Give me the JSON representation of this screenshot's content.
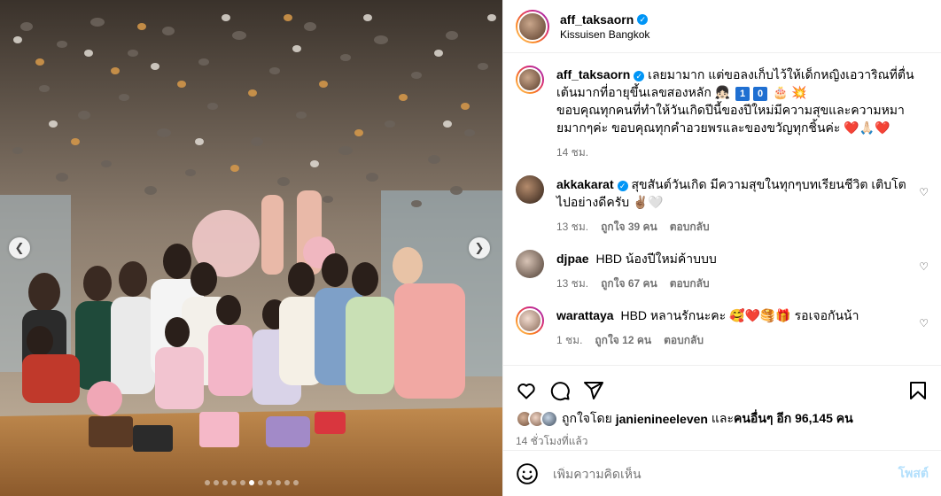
{
  "post": {
    "username": "aff_taksaorn",
    "location": "Kissuisen Bangkok",
    "caption_part1": "เลยมามาก แต่ขอลงเก็บไว้ให้เด็กหญิงเอวาริณที่ตื่นเต้นมากที่อายุขึ้นเลขสองหลัก",
    "caption_digit1": "1",
    "caption_digit2": "0",
    "caption_part2": "ขอบคุณทุกคนที่ทำให้วันเกิดปีนี้ของปีใหม่มีความสุขและความหมายมากๆค่ะ ขอบคุณทุกคำอวยพรและของขวัญทุกชิ้นค่ะ",
    "caption_time": "14 ชม.",
    "carousel_total": 11,
    "carousel_active": 5
  },
  "comments": [
    {
      "user": "akkakarat",
      "verified": true,
      "text": "สุขสันต์วันเกิด มีความสุขในทุกๆบทเรียนชีวิต เติบโตไปอย่างดีครับ ✌🏽🤍",
      "time": "13 ชม.",
      "likes": "ถูกใจ 39 คน",
      "reply": "ตอบกลับ"
    },
    {
      "user": "djpae",
      "verified": false,
      "text": "HBD น้องปีใหม่ค้าบบบ",
      "time": "13 ชม.",
      "likes": "ถูกใจ 67 คน",
      "reply": "ตอบกลับ"
    },
    {
      "user": "warattaya",
      "verified": false,
      "text": "HBD หลานรักนะคะ 🥰❤️🥞🎁 รอเจอกันน้า",
      "time": "1 ชม.",
      "likes": "ถูกใจ 12 คน",
      "reply": "ตอบกลับ"
    }
  ],
  "likes": {
    "prefix": "ถูกใจโดย",
    "user": "janienineeleven",
    "middle": "และ",
    "others": "คนอื่นๆ อีก 96,145 คน"
  },
  "timestamp": "14 ชั่วโมงที่แล้ว",
  "add_comment": {
    "placeholder": "เพิ่มความคิดเห็น",
    "post_label": "โพสต์"
  },
  "icons": {
    "like": "heart-icon",
    "comment": "comment-icon",
    "share": "share-icon",
    "save": "bookmark-icon",
    "emoji": "emoji-icon",
    "more": "more-icon"
  },
  "colors": {
    "verified": "#0095f6",
    "post_disabled": "#b2dffc",
    "muted": "#737373"
  }
}
